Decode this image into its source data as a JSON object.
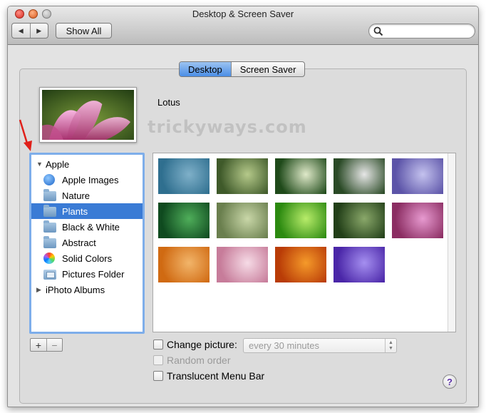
{
  "window": {
    "title": "Desktop & Screen Saver"
  },
  "toolbar": {
    "back_label": "◀",
    "forward_label": "▶",
    "show_all_label": "Show All",
    "search_placeholder": "",
    "search_value": ""
  },
  "tabs": [
    {
      "label": "Desktop",
      "active": true
    },
    {
      "label": "Screen Saver",
      "active": false
    }
  ],
  "preview": {
    "name": "Lotus"
  },
  "watermark": "trickyways.com",
  "sidebar": {
    "items": [
      {
        "label": "Apple",
        "kind": "group",
        "expanded": true,
        "icon": "disclosure-down-icon"
      },
      {
        "label": "Apple Images",
        "kind": "item",
        "icon": "apple-icon"
      },
      {
        "label": "Nature",
        "kind": "item",
        "icon": "folder-icon"
      },
      {
        "label": "Plants",
        "kind": "item",
        "icon": "folder-icon",
        "selected": true
      },
      {
        "label": "Black & White",
        "kind": "item",
        "icon": "folder-icon"
      },
      {
        "label": "Abstract",
        "kind": "item",
        "icon": "folder-icon"
      },
      {
        "label": "Solid Colors",
        "kind": "item",
        "icon": "color-wheel-icon"
      },
      {
        "label": "Pictures Folder",
        "kind": "item",
        "icon": "pictures-folder-icon"
      },
      {
        "label": "iPhoto Albums",
        "kind": "group",
        "expanded": false,
        "icon": "disclosure-right-icon"
      }
    ],
    "add_label": "+",
    "remove_label": "−"
  },
  "thumbnails": [
    {
      "name": "agave",
      "colors": [
        "#2f6f8f",
        "#7fb0c9"
      ]
    },
    {
      "name": "bamboo",
      "colors": [
        "#3f5a2a",
        "#b5c98a"
      ]
    },
    {
      "name": "daisies",
      "colors": [
        "#1f4a1a",
        "#dfe9c9"
      ]
    },
    {
      "name": "dandelion",
      "colors": [
        "#2a4a26",
        "#e6e6e6"
      ]
    },
    {
      "name": "purple-petals",
      "colors": [
        "#5c54a8",
        "#c4c2ee"
      ]
    },
    {
      "name": "grass-dew",
      "colors": [
        "#0f4a1f",
        "#4fae5a"
      ]
    },
    {
      "name": "meadow",
      "colors": [
        "#6a7f4e",
        "#c9d7a8"
      ]
    },
    {
      "name": "green-leaf",
      "colors": [
        "#2c8a10",
        "#b8ec6a"
      ]
    },
    {
      "name": "moss",
      "colors": [
        "#223f18",
        "#8aa86a"
      ]
    },
    {
      "name": "lotus",
      "colors": [
        "#8b2d62",
        "#e79ad0"
      ]
    },
    {
      "name": "maple",
      "colors": [
        "#d06a12",
        "#f2b56a"
      ]
    },
    {
      "name": "pink-bloom",
      "colors": [
        "#c77c9a",
        "#f6dbe6"
      ]
    },
    {
      "name": "orange-rose",
      "colors": [
        "#b93c07",
        "#f59a2a"
      ]
    },
    {
      "name": "violet-petals",
      "colors": [
        "#4a26a8",
        "#a58ff0"
      ]
    }
  ],
  "options": {
    "change_picture_label": "Change picture:",
    "interval_value": "every 30 minutes",
    "random_order_label": "Random order",
    "translucent_label": "Translucent Menu Bar"
  },
  "help_label": "?",
  "colors": {
    "accent": "#3a7bd5",
    "selection_border": "#7eaeea",
    "annotation_arrow": "#e0201a"
  }
}
